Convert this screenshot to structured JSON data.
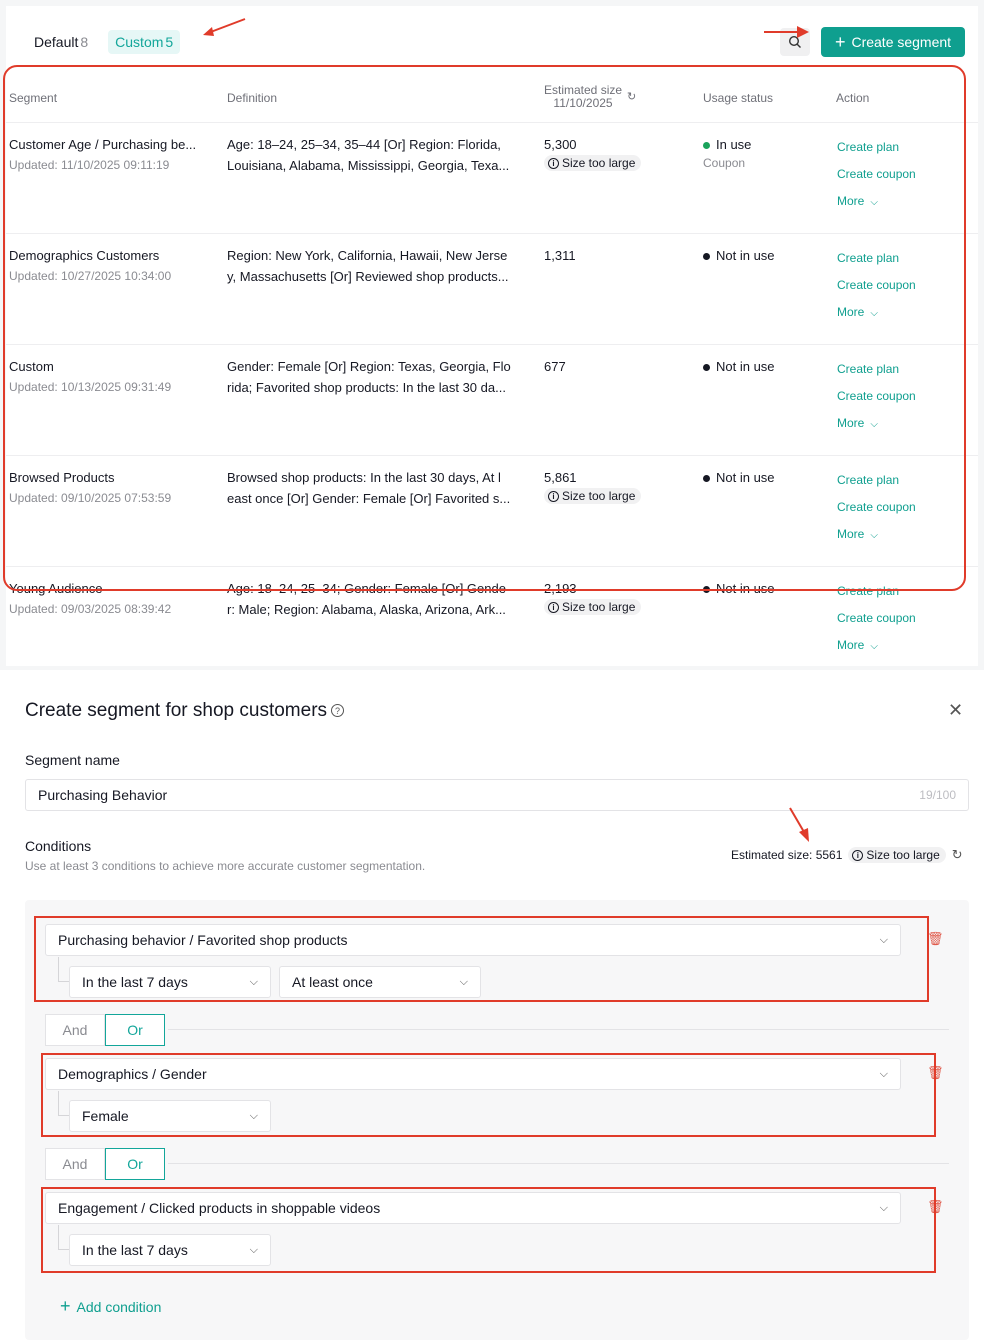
{
  "tabs": [
    {
      "label": "Default",
      "count": "8",
      "active": false
    },
    {
      "label": "Custom",
      "count": "5",
      "active": true
    }
  ],
  "header": {
    "create_label": "Create segment",
    "search_icon": "search-icon"
  },
  "table": {
    "columns": {
      "segment": "Segment",
      "definition": "Definition",
      "estimated": "Estimated size",
      "estimated_date": "11/10/2025",
      "usage": "Usage status",
      "action": "Action"
    },
    "rows": [
      {
        "name": "Customer Age / Purchasing be...",
        "updated": "Updated:  11/10/2025 09:11:19",
        "def1": "Age: 18–24, 25–34, 35–44 [Or] Region: Florida,",
        "def2": "Louisiana, Alabama, Mississippi, Georgia, Texa...",
        "size": "5,300",
        "badge": "Size too large",
        "status": "In use",
        "status_sub": "Coupon",
        "status_color": "#1aa35b"
      },
      {
        "name": "Demographics Customers",
        "updated": "Updated:  10/27/2025 10:34:00",
        "def1": "Region: New York, California, Hawaii, New Jerse",
        "def2": "y, Massachusetts [Or] Reviewed shop products...",
        "size": "1,311",
        "badge": "",
        "status": "Not in use",
        "status_sub": "",
        "status_color": "#161823"
      },
      {
        "name": "Custom",
        "updated": "Updated:  10/13/2025 09:31:49",
        "def1": "Gender: Female [Or] Region: Texas, Georgia, Flo",
        "def2": "rida; Favorited shop products: In the last 30 da...",
        "size": "677",
        "badge": "",
        "status": "Not in use",
        "status_sub": "",
        "status_color": "#161823"
      },
      {
        "name": "Browsed Products",
        "updated": "Updated:  09/10/2025 07:53:59",
        "def1": "Browsed shop products: In the last 30 days, At l",
        "def2": "east once [Or] Gender: Female [Or] Favorited s...",
        "size": "5,861",
        "badge": "Size too large",
        "status": "Not in use",
        "status_sub": "",
        "status_color": "#161823"
      },
      {
        "name": "Young Audience",
        "updated": "Updated:  09/03/2025 08:39:42",
        "def1": "Age: 18–24, 25–34; Gender: Female [Or] Gende",
        "def2": "r: Male; Region: Alabama, Alaska, Arizona, Ark...",
        "size": "2,193",
        "badge": "Size too large",
        "status": "Not in use",
        "status_sub": "",
        "status_color": "#161823"
      }
    ],
    "actions": {
      "plan": "Create plan",
      "coupon": "Create coupon",
      "more": "More"
    }
  },
  "form": {
    "title": "Create segment for shop customers",
    "name_label": "Segment name",
    "name_value": "Purchasing Behavior",
    "name_counter": "19/100",
    "conditions_label": "Conditions",
    "conditions_hint": "Use at least 3 conditions to achieve more accurate customer segmentation.",
    "estimated_text": "Estimated size: 5561",
    "estimated_badge": "Size too large",
    "and_label": "And",
    "or_label": "Or",
    "add_condition": "Add condition",
    "conditions": [
      {
        "main": "Purchasing behavior / Favorited shop products",
        "sub1": "In the last 7 days",
        "sub2": "At least once"
      },
      {
        "main": "Demographics / Gender",
        "sub1": "Female"
      },
      {
        "main": "Engagement / Clicked products in shoppable videos",
        "sub1": "In the last 7 days"
      }
    ]
  },
  "colors": {
    "accent": "#0f9f8f",
    "annotation": "#e03b2a"
  }
}
